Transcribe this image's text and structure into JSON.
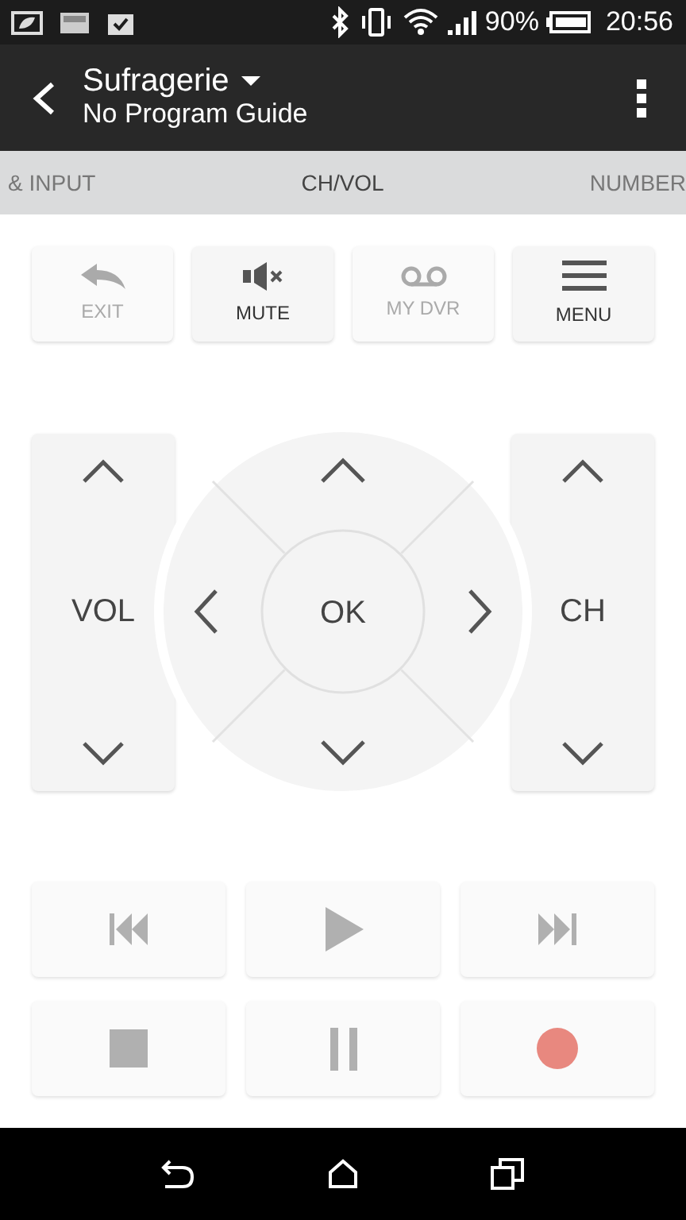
{
  "status_bar": {
    "battery": "90%",
    "time": "20:56"
  },
  "header": {
    "title": "Sufragerie",
    "subtitle": "No Program Guide"
  },
  "tabs": [
    {
      "label": "& INPUT",
      "selected": false
    },
    {
      "label": "CH/VOL",
      "selected": true
    },
    {
      "label": "NUMBER",
      "selected": false
    }
  ],
  "top_buttons": [
    {
      "label": "EXIT",
      "kind": "exit",
      "disabled": true
    },
    {
      "label": "MUTE",
      "kind": "mute",
      "disabled": false
    },
    {
      "label": "MY DVR",
      "kind": "dvr",
      "disabled": true
    },
    {
      "label": "MENU",
      "kind": "menu",
      "disabled": false
    }
  ],
  "dpad": {
    "left_rocker": {
      "label": "VOL"
    },
    "center": {
      "label": "OK"
    },
    "right_rocker": {
      "label": "CH"
    }
  },
  "media_buttons": [
    {
      "kind": "previous"
    },
    {
      "kind": "play"
    },
    {
      "kind": "next"
    },
    {
      "kind": "stop"
    },
    {
      "kind": "pause"
    },
    {
      "kind": "record"
    }
  ]
}
